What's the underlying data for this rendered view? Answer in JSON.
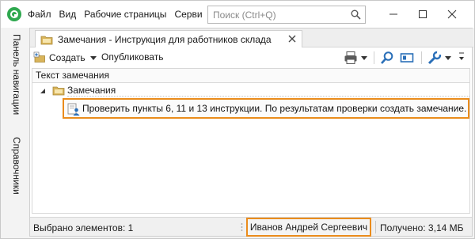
{
  "menu": {
    "items": [
      "Файл",
      "Вид",
      "Рабочие страницы",
      "Серви"
    ]
  },
  "search": {
    "placeholder": "Поиск (Ctrl+Q)"
  },
  "left_panel": {
    "navigation_label": "Панель навигации",
    "references_label": "Справочники"
  },
  "document_tab": {
    "title": "Замечания - Инструкция для работников склада"
  },
  "toolbar": {
    "create_label": "Создать",
    "publish_label": "Опубликовать"
  },
  "grid": {
    "column_header": "Текст замечания",
    "folder_row": "Замечания",
    "note_row": "Проверить пункты 6, 11 и 13 инструкции. По результатам проверки создать замечание."
  },
  "status_bar": {
    "selected": "Выбрано элементов: 1",
    "user": "Иванов Андрей Сергеевич",
    "received": "Получено: 3,14 МБ"
  },
  "colors": {
    "accent_highlight": "#ea8c1c",
    "app_logo": "#2fa84f",
    "toolbar_icon_blue": "#2a6fb8"
  },
  "icons": {
    "app": "app-logo-icon",
    "search": "search-icon",
    "minimize": "minimize-icon",
    "maximize": "maximize-icon",
    "close": "close-icon",
    "document": "folder-document-icon",
    "create": "create-document-icon",
    "print": "printer-icon",
    "find": "magnifier-icon",
    "view": "panel-view-icon",
    "settings": "wrench-icon",
    "expander": "tree-expander-icon",
    "note": "note-user-icon"
  }
}
